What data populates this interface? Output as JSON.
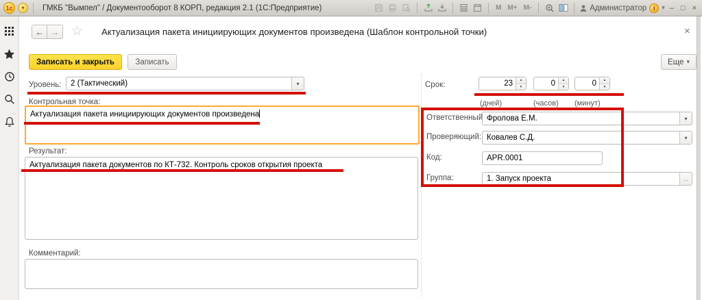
{
  "colors": {
    "annotation_red": "#d40f06",
    "field_highlight_orange": "#ffa832",
    "accent_yellow": "#fcd22b"
  },
  "icons": {
    "back": "←",
    "forward": "→",
    "favorite_star": "☆",
    "close": "×",
    "caret_down": "▾",
    "ellipsis": "…",
    "minimize": "–",
    "maximize": "□",
    "spin_up": "▲",
    "spin_down": "▼",
    "logo_text": "1с",
    "info": "i"
  },
  "titlebar": {
    "app_title": "ГМКБ \"Вымпел\" / Документооборот 8 КОРП, редакция 2.1  (1С:Предприятие)",
    "user": "Администратор",
    "memory": {
      "m": "M",
      "m_plus": "M+",
      "m_minus": "M-"
    }
  },
  "form_header": {
    "title": "Актуализация пакета инициирующих документов произведена (Шаблон контрольной точки)"
  },
  "toolbar": {
    "save_and_close": "Записать и закрыть",
    "save": "Записать",
    "more": "Еще"
  },
  "fields": {
    "level": {
      "label": "Уровень:",
      "value": "2 (Тактический)"
    },
    "control_point": {
      "label": "Контрольная точка:",
      "value": "Актуализация пакета инициирующих документов произведена"
    },
    "result": {
      "label": "Результат:",
      "value": "Актуализация пакета документов по КТ-732. Контроль сроков открытия проекта"
    },
    "comment": {
      "label": "Комментарий:",
      "value": ""
    },
    "term": {
      "label": "Срок:",
      "days": "23",
      "hours": "0",
      "minutes": "0",
      "units": {
        "days": "(дней)",
        "hours": "(часов)",
        "minutes": "(минут)"
      }
    },
    "responsible": {
      "label": "Ответственный:",
      "value": "Фролова Е.М."
    },
    "reviewer": {
      "label": "Проверяющий:",
      "value": "Ковалев С.Д."
    },
    "code": {
      "label": "Код:",
      "value": "APR.0001"
    },
    "group": {
      "label": "Группа:",
      "value": "1. Запуск проекта"
    }
  }
}
